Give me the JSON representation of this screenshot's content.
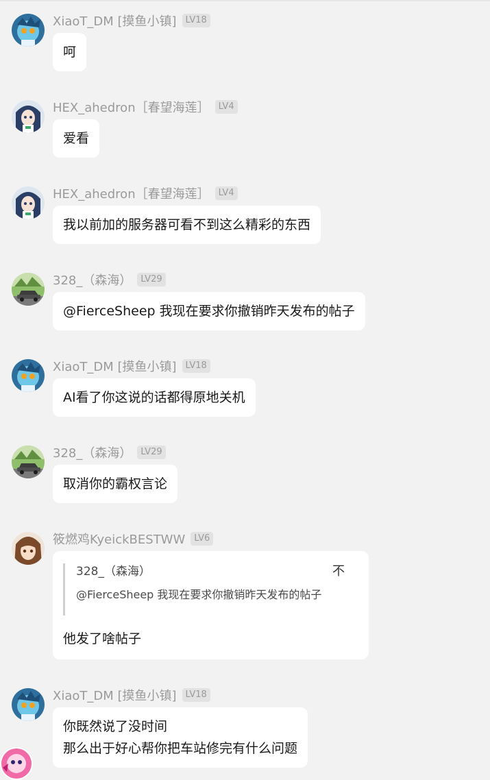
{
  "messages": [
    {
      "sender": "XiaoT_DM [摸鱼小镇]",
      "level": "LV18",
      "avatar": "blue-anime-avatar",
      "lines": [
        "呵"
      ]
    },
    {
      "sender": "HEX_ahedron［春望海莲］",
      "level": "LV4",
      "avatar": "anime-girl-avatar",
      "lines": [
        "爱看"
      ]
    },
    {
      "sender": "HEX_ahedron［春望海莲］",
      "level": "LV4",
      "avatar": "anime-girl-avatar",
      "lines": [
        "我以前加的服务器可看不到这么精彩的东西"
      ]
    },
    {
      "sender": "328_（森海）",
      "level": "LV29",
      "avatar": "car-avatar",
      "lines": [
        "@FierceSheep 我现在要求你撤销昨天发布的帖子"
      ]
    },
    {
      "sender": "XiaoT_DM [摸鱼小镇]",
      "level": "LV18",
      "avatar": "blue-anime-avatar",
      "lines": [
        "AI看了你这说的话都得原地关机"
      ]
    },
    {
      "sender": "328_（森海）",
      "level": "LV29",
      "avatar": "car-avatar",
      "lines": [
        "取消你的霸权言论"
      ]
    },
    {
      "sender": "筱燃鸡KyeickBESTWW",
      "level": "LV6",
      "avatar": "brown-hair-avatar",
      "quote": {
        "sender": "328_（森海）",
        "text": "@FierceSheep 我现在要求你撤销昨天发布的帖子",
        "pin": "不"
      },
      "lines": [
        "他发了啥帖子"
      ]
    },
    {
      "sender": "XiaoT_DM [摸鱼小镇]",
      "level": "LV18",
      "avatar": "blue-anime-avatar",
      "lines": [
        "你既然说了没时间",
        "那么出于好心帮你把车站修完有什么问题"
      ]
    }
  ],
  "colors": {
    "background": "#f2f2f2",
    "bubble": "#ffffff",
    "meta_text": "#9a9a9a",
    "level_badge": "#e2e2e2"
  }
}
